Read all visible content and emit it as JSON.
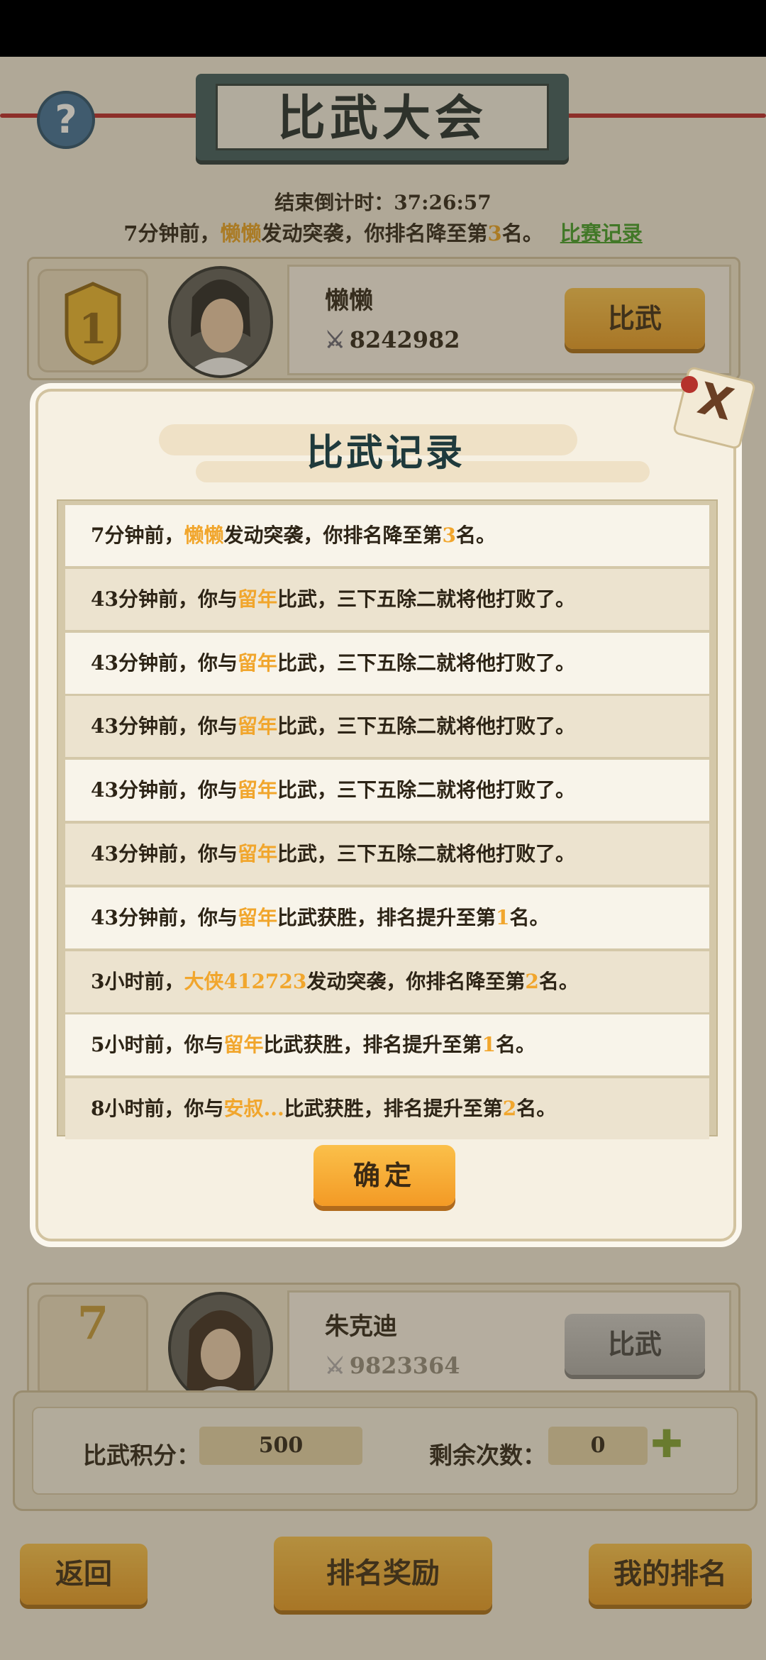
{
  "header": {
    "title": "比武大会",
    "help_icon": "?",
    "countdown": "结束倒计时：37:26:57",
    "notice_prefix": "7分钟前，",
    "notice_name": "懒懒",
    "notice_mid": "发动突袭，你排名降至第",
    "notice_rank": "3",
    "notice_suffix": "名。",
    "record_link": "比赛记录"
  },
  "top_player": {
    "rank": "1",
    "name": "懒懒",
    "power": "8242982",
    "duel_label": "比武"
  },
  "seventh_player": {
    "rank": "7",
    "name": "朱克迪",
    "power": "9823364",
    "duel_label": "比武"
  },
  "stats": {
    "score_label": "比武积分：",
    "score_value": "500",
    "remaining_label": "剩余次数：",
    "remaining_value": "0"
  },
  "bottom_nav": {
    "back": "返回",
    "rank_reward": "排名奖励",
    "my_rank": "我的排名"
  },
  "modal": {
    "title": "比武记录",
    "close_icon": "X",
    "confirm": "确定",
    "records": [
      {
        "time": "7分钟前，",
        "pre": "",
        "name": "懒懒",
        "post": "发动突袭，你排名降至第",
        "rank": "3",
        "end": "名。"
      },
      {
        "time": "43分钟前，",
        "pre": "你与",
        "name": "留年",
        "post": "比武，三下五除二就将他打败了。",
        "rank": "",
        "end": ""
      },
      {
        "time": "43分钟前，",
        "pre": "你与",
        "name": "留年",
        "post": "比武，三下五除二就将他打败了。",
        "rank": "",
        "end": ""
      },
      {
        "time": "43分钟前，",
        "pre": "你与",
        "name": "留年",
        "post": "比武，三下五除二就将他打败了。",
        "rank": "",
        "end": ""
      },
      {
        "time": "43分钟前，",
        "pre": "你与",
        "name": "留年",
        "post": "比武，三下五除二就将他打败了。",
        "rank": "",
        "end": ""
      },
      {
        "time": "43分钟前，",
        "pre": "你与",
        "name": "留年",
        "post": "比武，三下五除二就将他打败了。",
        "rank": "",
        "end": ""
      },
      {
        "time": "43分钟前，",
        "pre": "你与",
        "name": "留年",
        "post": "比武获胜，排名提升至第",
        "rank": "1",
        "end": "名。"
      },
      {
        "time": "3小时前，",
        "pre": "",
        "name": "大侠412723",
        "post": "发动突袭，你排名降至第",
        "rank": "2",
        "end": "名。"
      },
      {
        "time": "5小时前，",
        "pre": "你与",
        "name": "留年",
        "post": "比武获胜，排名提升至第",
        "rank": "1",
        "end": "名。"
      },
      {
        "time": "8小时前，",
        "pre": "你与",
        "name": "安叔...",
        "post": "比武获胜，排名提升至第",
        "rank": "2",
        "end": "名。"
      }
    ]
  },
  "colors": {
    "highlight": "#f1a62d",
    "link": "#3f9d29",
    "button_gold": "#f39a25"
  }
}
